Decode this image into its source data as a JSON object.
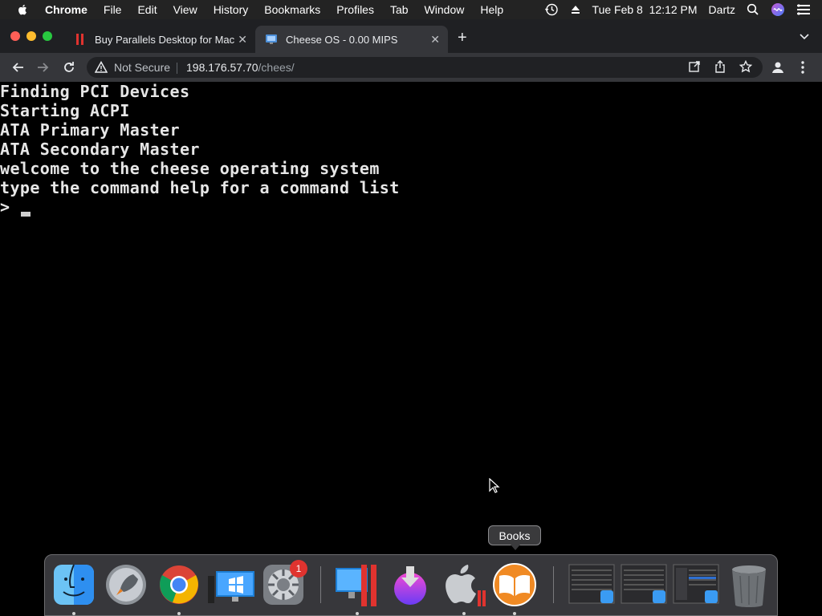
{
  "menubar": {
    "app": "Chrome",
    "items": [
      "File",
      "Edit",
      "View",
      "History",
      "Bookmarks",
      "Profiles",
      "Tab",
      "Window",
      "Help"
    ],
    "clock": "Tue Feb 8  12:12 PM",
    "user": "Dartz"
  },
  "tabs": [
    {
      "title": "Buy Parallels Desktop for Mac",
      "active": false
    },
    {
      "title": "Cheese OS - 0.00 MIPS",
      "active": true
    }
  ],
  "toolbar": {
    "security_label": "Not Secure",
    "url_host": "198.176.57.70",
    "url_path": "/chees/"
  },
  "console": {
    "lines": [
      "Finding PCI Devices",
      "Starting ACPI",
      "ATA Primary Master",
      "ATA Secondary Master",
      "welcome to the cheese operating system",
      "type the command help for a command list"
    ],
    "prompt": ">"
  },
  "dock": {
    "tooltip": "Books",
    "badge_count": "1"
  },
  "colors": {
    "accent_red": "#e0332f",
    "console_text": "#e6e6e6",
    "tab_active": "#35363a"
  }
}
